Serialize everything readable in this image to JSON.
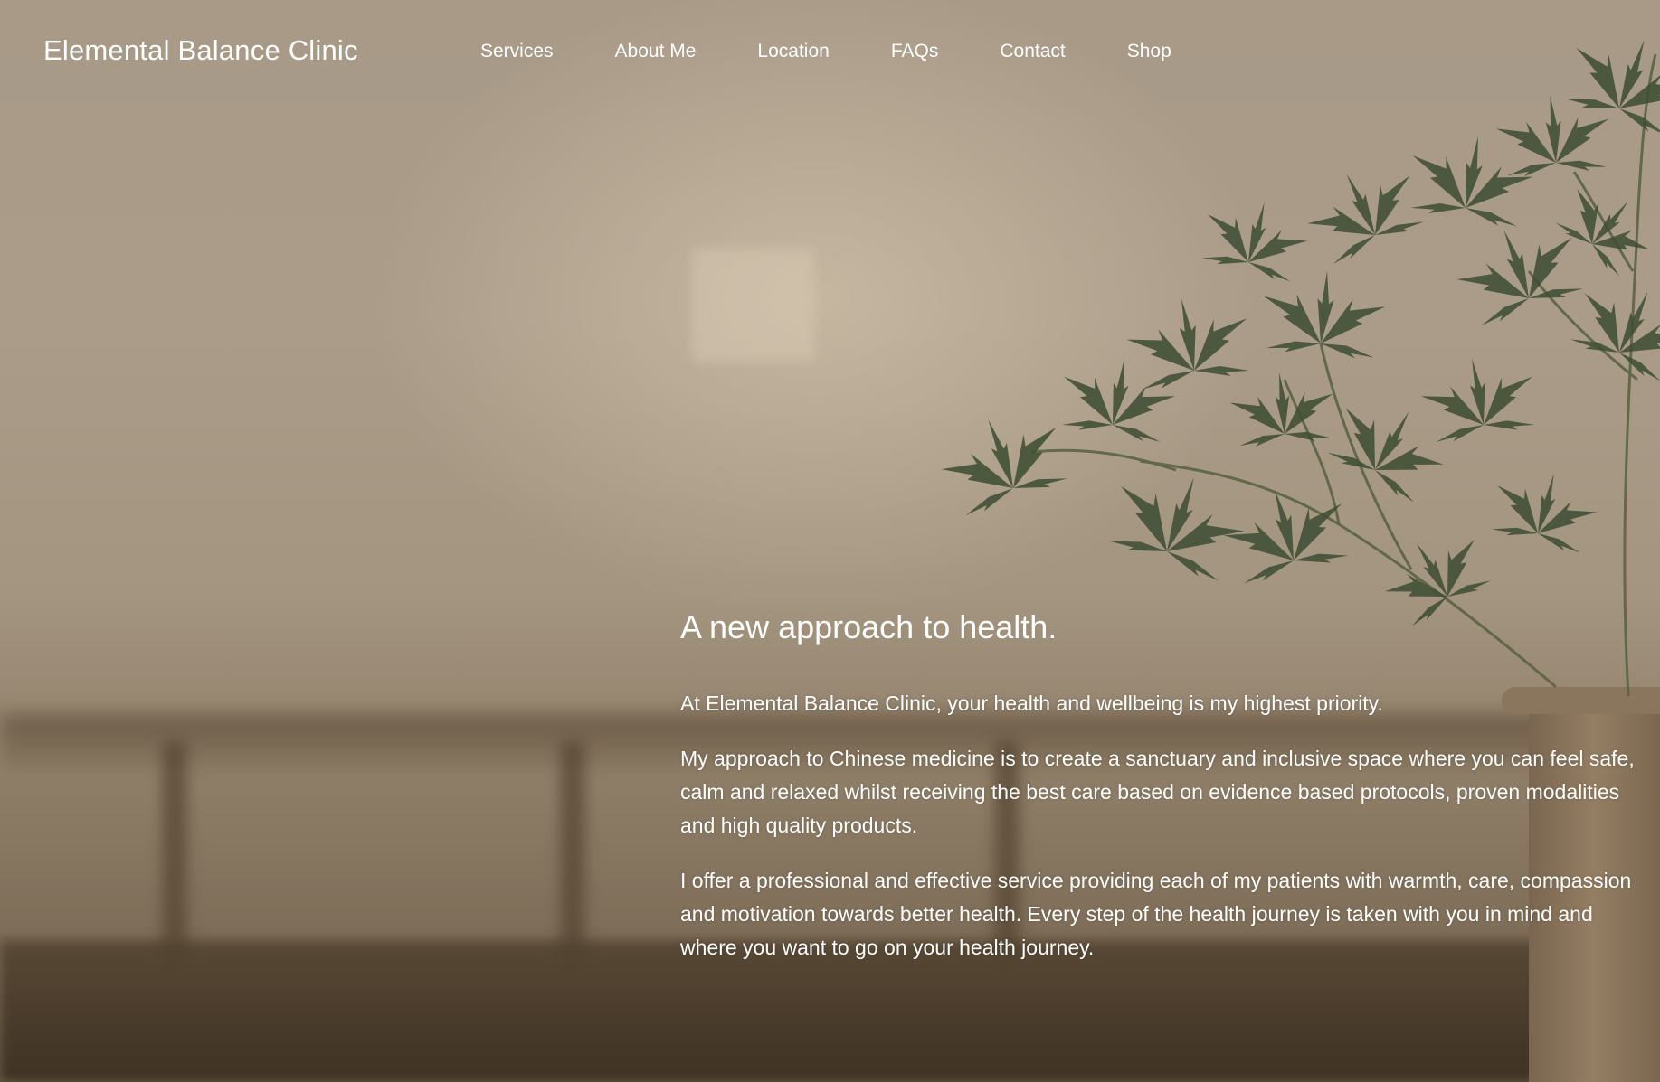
{
  "header": {
    "logo": "Elemental Balance Clinic",
    "nav": {
      "services": "Services",
      "about": "About Me",
      "location": "Location",
      "faqs": "FAQs",
      "contact": "Contact",
      "shop": "Shop"
    }
  },
  "hero": {
    "heading": "A new approach to health.",
    "paragraphs": [
      "At Elemental Balance Clinic, your health and wellbeing is my highest priority.",
      "My approach to Chinese medicine is to create a sanctuary and inclusive space where you can feel safe, calm and relaxed whilst receiving the best care based on evidence based protocols, proven modalities and high quality products.",
      "I offer a professional and effective service providing each of my patients with warmth, care, compassion and motivation towards better health. Every step of the health journey is taken with you in mind and where you want to go on your health journey."
    ]
  },
  "colors": {
    "text": "#ffffff",
    "leaf": "#3f4f35",
    "background": "#a89a87"
  },
  "background_image": {
    "icon": "maple-leaf-plant-icon"
  }
}
